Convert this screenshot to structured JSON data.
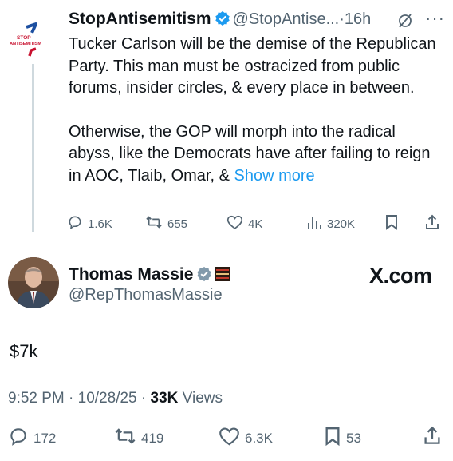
{
  "tweet1": {
    "display_name": "StopAntisemitism",
    "handle": "@StopAntise...",
    "separator": "·",
    "time": "16h",
    "more": "···",
    "logo": {
      "line1": "STOP",
      "line2": "ANTISEMITISM"
    },
    "paragraph1": "Tucker Carlson will be the demise of the Republican Party. This man must be ostracized from public forums, insider circles, & every place in between.",
    "paragraph2": "Otherwise, the GOP will morph into the radical abyss, like the Democrats have after failing to reign in AOC, Tlaib, Omar, &",
    "show_more": "Show more",
    "replies": "1.6K",
    "reposts": "655",
    "likes": "4K",
    "views": "320K"
  },
  "tweet2": {
    "display_name": "Thomas Massie",
    "handle": "@RepThomasMassie",
    "watermark": "X.com",
    "text": "$7k",
    "time": "9:52 PM",
    "separator": "·",
    "date": "10/28/25",
    "views_count": "33K",
    "views_label": "Views",
    "replies": "172",
    "reposts": "419",
    "likes": "6.3K",
    "bookmarks": "53"
  },
  "colors": {
    "text": "#0f1419",
    "secondary": "#536471",
    "link": "#1d9bf0",
    "verified": "#829aab",
    "logo_red": "#c8102e",
    "logo_blue": "#1c4fa0"
  },
  "icons": [
    "verified-badge-icon",
    "grok-icon",
    "reply-icon",
    "repost-icon",
    "like-icon",
    "views-icon",
    "bookmark-icon",
    "share-icon",
    "affiliate-badge-icon"
  ]
}
